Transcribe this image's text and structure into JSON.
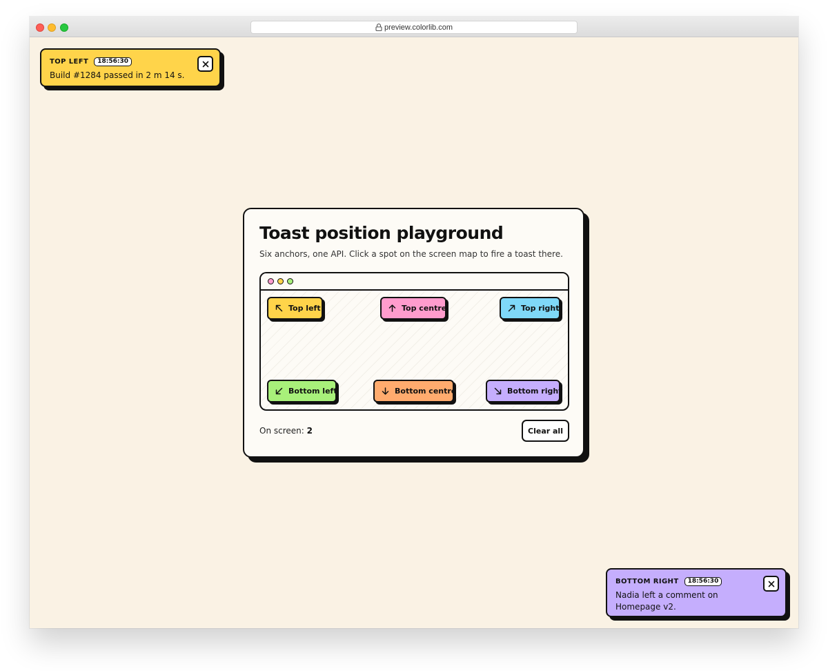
{
  "browser": {
    "url": "preview.colorlib.com"
  },
  "toasts": [
    {
      "position": "TOP LEFT",
      "time": "18:56:30",
      "message": "Build #1284 passed in 2 m 14 s.",
      "color": "#ffd44a"
    },
    {
      "position": "BOTTOM RIGHT",
      "time": "18:56:30",
      "message": "Nadia left a comment on Homepage v2.",
      "color": "#c5aefd"
    }
  ],
  "card": {
    "title": "Toast position playground",
    "subtitle": "Six anchors, one API. Click a spot on the screen map to fire a toast there.",
    "map_dots": [
      "#ff9ccd",
      "#ffd44a",
      "#a8f07a"
    ],
    "buttons": [
      {
        "label": "Top left",
        "icon": "arrow-up-left-icon",
        "color": "#ffd44a"
      },
      {
        "label": "Top centre",
        "icon": "arrow-up-icon",
        "color": "#ff9ccd"
      },
      {
        "label": "Top right",
        "icon": "arrow-up-right-icon",
        "color": "#7fd8f8"
      },
      {
        "label": "Bottom left",
        "icon": "arrow-down-left-icon",
        "color": "#a8f07a"
      },
      {
        "label": "Bottom centre",
        "icon": "arrow-down-icon",
        "color": "#ffab6e"
      },
      {
        "label": "Bottom right",
        "icon": "arrow-down-right-icon",
        "color": "#c5aefd"
      }
    ],
    "footer": {
      "count_label": "On screen: ",
      "count_value": "2",
      "clear_label": "Clear all"
    }
  }
}
